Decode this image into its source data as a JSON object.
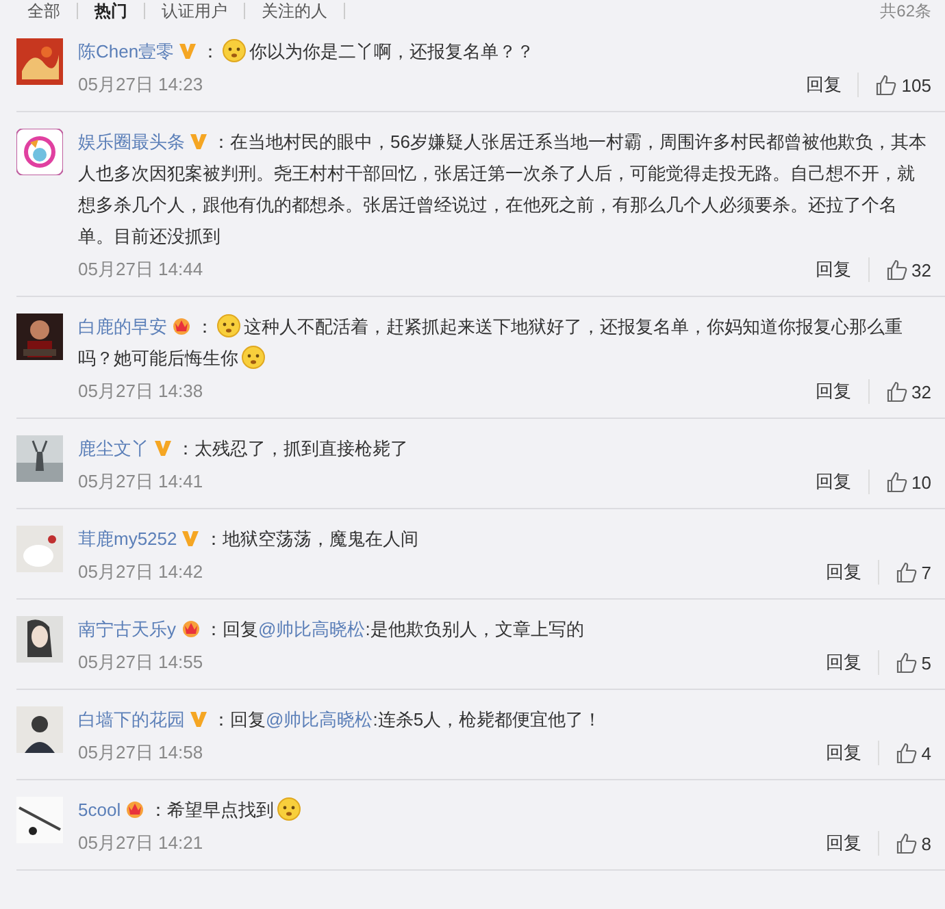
{
  "filter_tabs": [
    {
      "label": "全部",
      "selected": false
    },
    {
      "label": "热门",
      "selected": true
    },
    {
      "label": "认证用户",
      "selected": false
    },
    {
      "label": "关注的人",
      "selected": false
    }
  ],
  "total": "共62条",
  "comments": [
    {
      "avatar": {
        "kind": "picture"
      },
      "name": "陈Chen壹零",
      "badge": {
        "kind": "vip"
      },
      "separator": "：",
      "content": [
        {
          "kind": "emoji"
        },
        {
          "kind": "text",
          "text": "你以为你是二丫啊，还报复名单？？"
        }
      ],
      "time": "05月27日 14:23",
      "reply": "回复",
      "likes": "105"
    },
    {
      "avatar": {
        "kind": "picture"
      },
      "name": "娱乐圈最头条",
      "badge": {
        "kind": "vip"
      },
      "separator": "：",
      "content": [
        {
          "kind": "text",
          "text": "在当地村民的眼中，56岁嫌疑人张居迁系当地一村霸，周围许多村民都曾被他欺负，其本人也多次因犯案被判刑。尧王村村干部回忆，张居迁第一次杀了人后，可能觉得走投无路。自己想不开，就想多杀几个人，跟他有仇的都想杀。张居迁曾经说过，在他死之前，有那么几个人必须要杀。还拉了个名单。目前还没抓到"
        }
      ],
      "time": "05月27日 14:44",
      "reply": "回复",
      "likes": "32"
    },
    {
      "avatar": {
        "kind": "picture"
      },
      "name": "白鹿的早安",
      "badge": {
        "kind": "crown"
      },
      "separator": "：",
      "content": [
        {
          "kind": "emoji"
        },
        {
          "kind": "text",
          "text": "这种人不配活着，赶紧抓起来送下地狱好了，还报复名单，你妈知道你报复心那么重吗？她可能后悔生你"
        },
        {
          "kind": "emoji"
        }
      ],
      "time": "05月27日 14:38",
      "reply": "回复",
      "likes": "32"
    },
    {
      "avatar": {
        "kind": "picture"
      },
      "name": "鹿尘文丫",
      "badge": {
        "kind": "vip"
      },
      "separator": "：",
      "content": [
        {
          "kind": "text",
          "text": "太残忍了，抓到直接枪毙了"
        }
      ],
      "time": "05月27日 14:41",
      "reply": "回复",
      "likes": "10"
    },
    {
      "avatar": {
        "kind": "picture"
      },
      "name": "茸鹿my5252",
      "badge": {
        "kind": "vip"
      },
      "separator": "：",
      "content": [
        {
          "kind": "text",
          "text": "地狱空荡荡，魔鬼在人间"
        }
      ],
      "time": "05月27日 14:42",
      "reply": "回复",
      "likes": "7"
    },
    {
      "avatar": {
        "kind": "picture"
      },
      "name": "南宁古天乐y",
      "badge": {
        "kind": "crown"
      },
      "separator": "：",
      "content": [
        {
          "kind": "text",
          "text": "回复"
        },
        {
          "kind": "mention",
          "text": "@帅比高晓松"
        },
        {
          "kind": "text",
          "text": ":是他欺负别人，文章上写的"
        }
      ],
      "time": "05月27日 14:55",
      "reply": "回复",
      "likes": "5"
    },
    {
      "avatar": {
        "kind": "picture"
      },
      "name": "白墙下的花园",
      "badge": {
        "kind": "vip"
      },
      "separator": "：",
      "content": [
        {
          "kind": "text",
          "text": "回复"
        },
        {
          "kind": "mention",
          "text": "@帅比高晓松"
        },
        {
          "kind": "text",
          "text": ":连杀5人，枪毙都便宜他了！"
        }
      ],
      "time": "05月27日 14:58",
      "reply": "回复",
      "likes": "4"
    },
    {
      "avatar": {
        "kind": "picture"
      },
      "name": "5cool",
      "badge": {
        "kind": "crown"
      },
      "separator": "：",
      "content": [
        {
          "kind": "text",
          "text": "希望早点找到"
        },
        {
          "kind": "emoji"
        }
      ],
      "time": "05月27日 14:21",
      "reply": "回复",
      "likes": "8"
    }
  ]
}
